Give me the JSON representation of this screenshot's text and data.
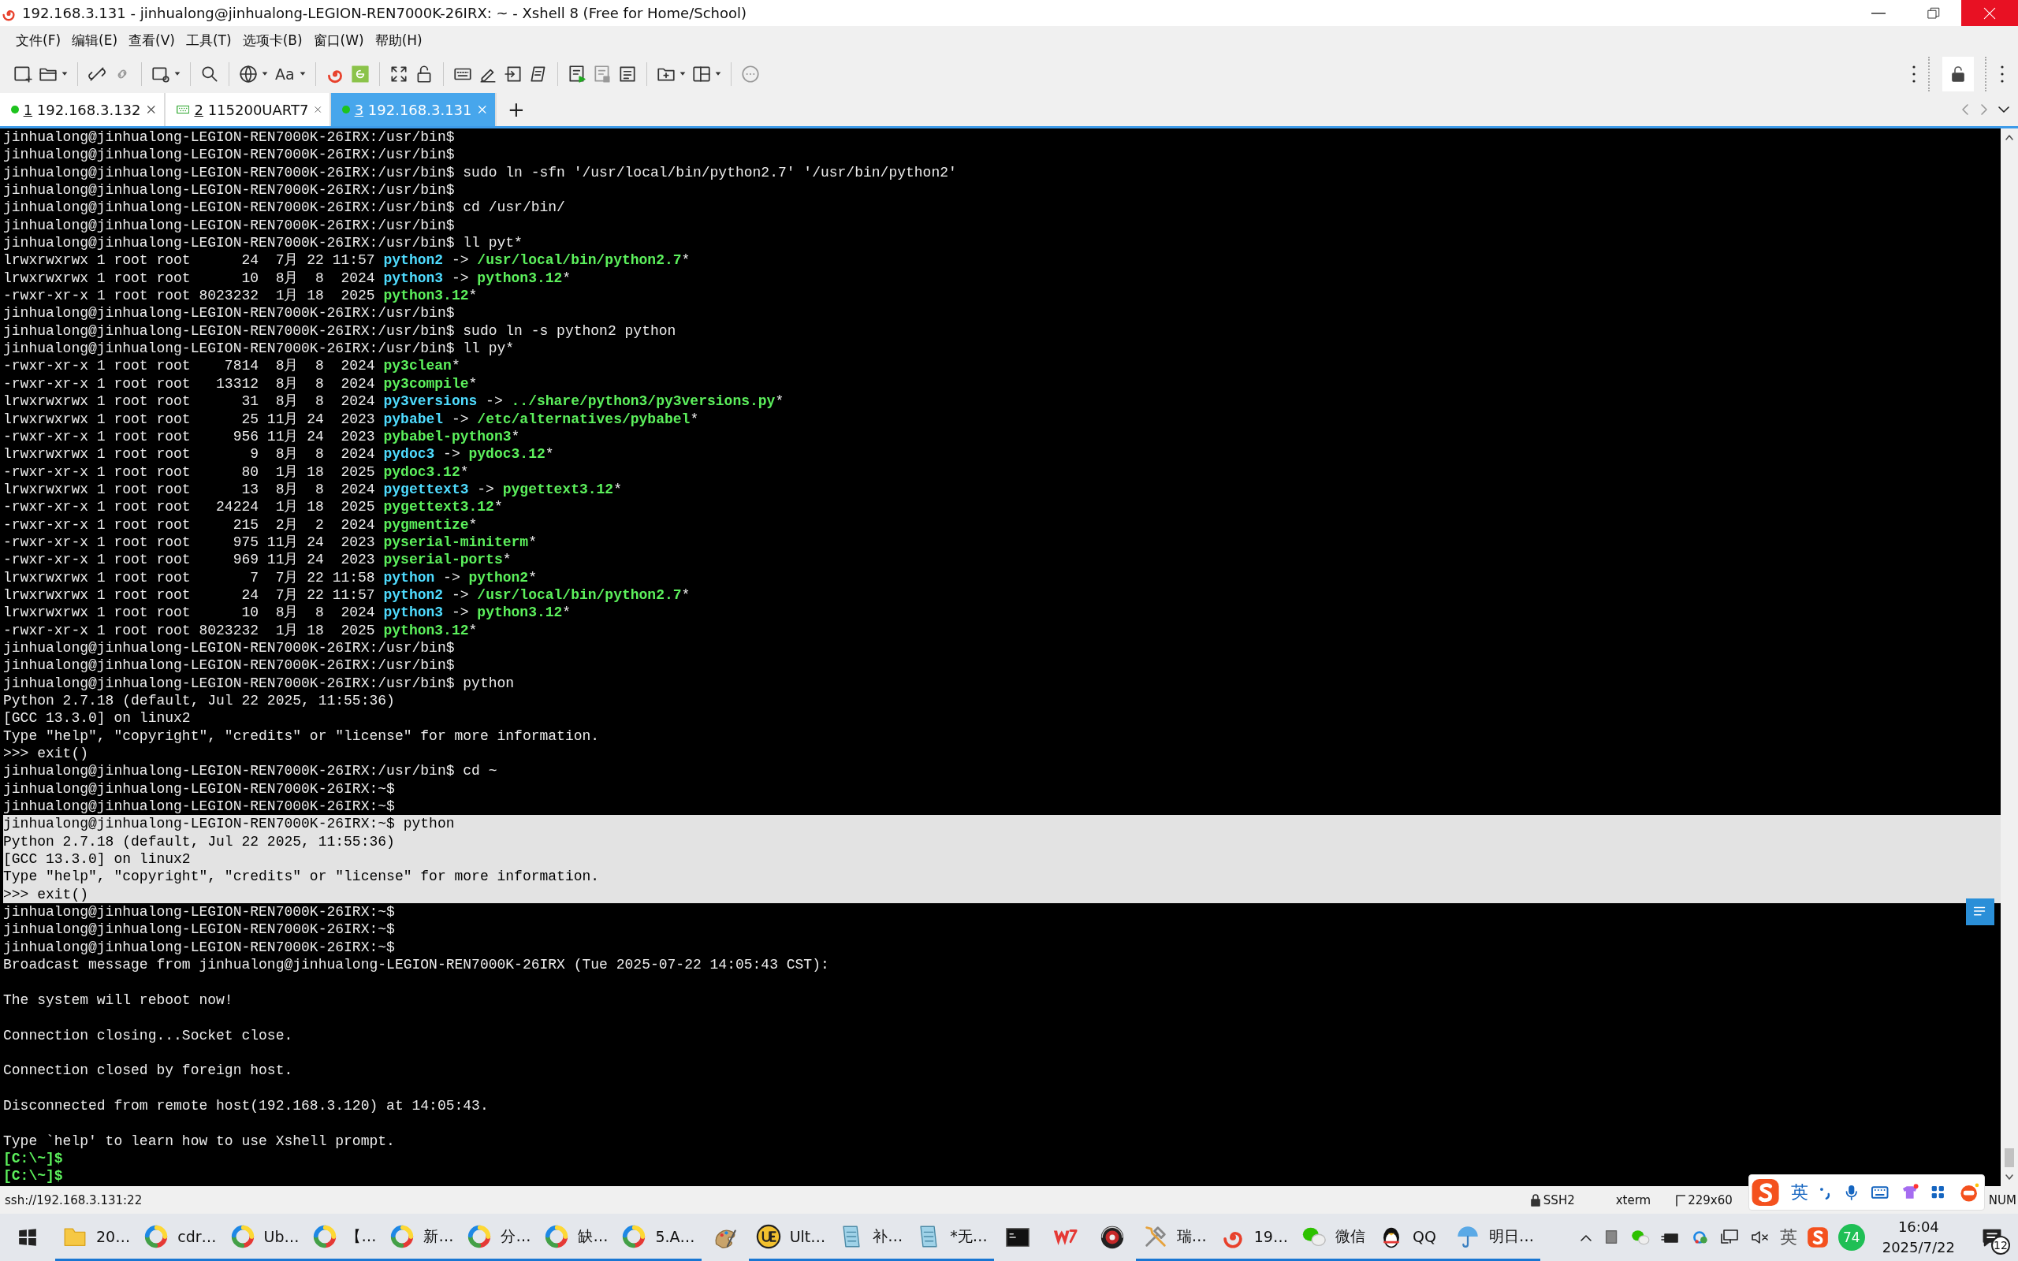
{
  "window": {
    "title": "192.168.3.131 - jinhualong@jinhualong-LEGION-REN7000K-26IRX: ~ - Xshell 8 (Free for Home/School)"
  },
  "menu": [
    "文件(F)",
    "编辑(E)",
    "查看(V)",
    "工具(T)",
    "选项卡(B)",
    "窗口(W)",
    "帮助(H)"
  ],
  "toolbar": {
    "font_button": "Aa"
  },
  "tabs": [
    {
      "number": "1",
      "label": "192.168.3.132",
      "kind": "ssh",
      "connected": true,
      "selected": false
    },
    {
      "number": "2",
      "label": "115200UART7",
      "kind": "serial",
      "selected": false
    },
    {
      "number": "3",
      "label": "192.168.3.131",
      "kind": "ssh",
      "connected": true,
      "selected": true
    }
  ],
  "new_tab": "+",
  "terminal": {
    "lines": [
      {
        "text": "jinhualong@jinhualong-LEGION-REN7000K-26IRX:/usr/bin$",
        "selected": false
      },
      {
        "text": "jinhualong@jinhualong-LEGION-REN7000K-26IRX:/usr/bin$",
        "selected": false
      },
      {
        "text": "jinhualong@jinhualong-LEGION-REN7000K-26IRX:/usr/bin$ sudo ln -sfn '/usr/local/bin/python2.7' '/usr/bin/python2'",
        "selected": false
      },
      {
        "text": "jinhualong@jinhualong-LEGION-REN7000K-26IRX:/usr/bin$",
        "selected": false
      },
      {
        "text": "jinhualong@jinhualong-LEGION-REN7000K-26IRX:/usr/bin$ cd /usr/bin/",
        "selected": false
      },
      {
        "text": "jinhualong@jinhualong-LEGION-REN7000K-26IRX:/usr/bin$",
        "selected": false
      },
      {
        "text": "jinhualong@jinhualong-LEGION-REN7000K-26IRX:/usr/bin$ ll pyt*",
        "selected": false
      },
      {
        "selected": false,
        "segments": [
          {
            "kind": "plain",
            "text": "lrwxrwxrwx 1 root root      24  7月 22 11:57 "
          },
          {
            "kind": "link",
            "text": "python2"
          },
          {
            "kind": "plain",
            "text": " -> "
          },
          {
            "kind": "exec",
            "text": "/usr/local/bin/python2.7"
          },
          {
            "kind": "plain",
            "text": "*"
          }
        ]
      },
      {
        "selected": false,
        "segments": [
          {
            "kind": "plain",
            "text": "lrwxrwxrwx 1 root root      10  8月  8  2024 "
          },
          {
            "kind": "link",
            "text": "python3"
          },
          {
            "kind": "plain",
            "text": " -> "
          },
          {
            "kind": "exec",
            "text": "python3.12"
          },
          {
            "kind": "plain",
            "text": "*"
          }
        ]
      },
      {
        "selected": false,
        "segments": [
          {
            "kind": "plain",
            "text": "-rwxr-xr-x 1 root root 8023232  1月 18  2025 "
          },
          {
            "kind": "exec",
            "text": "python3.12"
          },
          {
            "kind": "plain",
            "text": "*"
          }
        ]
      },
      {
        "text": "jinhualong@jinhualong-LEGION-REN7000K-26IRX:/usr/bin$",
        "selected": false
      },
      {
        "text": "jinhualong@jinhualong-LEGION-REN7000K-26IRX:/usr/bin$ sudo ln -s python2 python",
        "selected": false
      },
      {
        "text": "jinhualong@jinhualong-LEGION-REN7000K-26IRX:/usr/bin$ ll py*",
        "selected": false
      },
      {
        "selected": false,
        "segments": [
          {
            "kind": "plain",
            "text": "-rwxr-xr-x 1 root root    7814  8月  8  2024 "
          },
          {
            "kind": "exec",
            "text": "py3clean"
          },
          {
            "kind": "plain",
            "text": "*"
          }
        ]
      },
      {
        "selected": false,
        "segments": [
          {
            "kind": "plain",
            "text": "-rwxr-xr-x 1 root root   13312  8月  8  2024 "
          },
          {
            "kind": "exec",
            "text": "py3compile"
          },
          {
            "kind": "plain",
            "text": "*"
          }
        ]
      },
      {
        "selected": false,
        "segments": [
          {
            "kind": "plain",
            "text": "lrwxrwxrwx 1 root root      31  8月  8  2024 "
          },
          {
            "kind": "link",
            "text": "py3versions"
          },
          {
            "kind": "plain",
            "text": " -> "
          },
          {
            "kind": "exec",
            "text": "../share/python3/py3versions.py"
          },
          {
            "kind": "plain",
            "text": "*"
          }
        ]
      },
      {
        "selected": false,
        "segments": [
          {
            "kind": "plain",
            "text": "lrwxrwxrwx 1 root root      25 11月 24  2023 "
          },
          {
            "kind": "link",
            "text": "pybabel"
          },
          {
            "kind": "plain",
            "text": " -> "
          },
          {
            "kind": "exec",
            "text": "/etc/alternatives/pybabel"
          },
          {
            "kind": "plain",
            "text": "*"
          }
        ]
      },
      {
        "selected": false,
        "segments": [
          {
            "kind": "plain",
            "text": "-rwxr-xr-x 1 root root     956 11月 24  2023 "
          },
          {
            "kind": "exec",
            "text": "pybabel-python3"
          },
          {
            "kind": "plain",
            "text": "*"
          }
        ]
      },
      {
        "selected": false,
        "segments": [
          {
            "kind": "plain",
            "text": "lrwxrwxrwx 1 root root       9  8月  8  2024 "
          },
          {
            "kind": "link",
            "text": "pydoc3"
          },
          {
            "kind": "plain",
            "text": " -> "
          },
          {
            "kind": "exec",
            "text": "pydoc3.12"
          },
          {
            "kind": "plain",
            "text": "*"
          }
        ]
      },
      {
        "selected": false,
        "segments": [
          {
            "kind": "plain",
            "text": "-rwxr-xr-x 1 root root      80  1月 18  2025 "
          },
          {
            "kind": "exec",
            "text": "pydoc3.12"
          },
          {
            "kind": "plain",
            "text": "*"
          }
        ]
      },
      {
        "selected": false,
        "segments": [
          {
            "kind": "plain",
            "text": "lrwxrwxrwx 1 root root      13  8月  8  2024 "
          },
          {
            "kind": "link",
            "text": "pygettext3"
          },
          {
            "kind": "plain",
            "text": " -> "
          },
          {
            "kind": "exec",
            "text": "pygettext3.12"
          },
          {
            "kind": "plain",
            "text": "*"
          }
        ]
      },
      {
        "selected": false,
        "segments": [
          {
            "kind": "plain",
            "text": "-rwxr-xr-x 1 root root   24224  1月 18  2025 "
          },
          {
            "kind": "exec",
            "text": "pygettext3.12"
          },
          {
            "kind": "plain",
            "text": "*"
          }
        ]
      },
      {
        "selected": false,
        "segments": [
          {
            "kind": "plain",
            "text": "-rwxr-xr-x 1 root root     215  2月  2  2024 "
          },
          {
            "kind": "exec",
            "text": "pygmentize"
          },
          {
            "kind": "plain",
            "text": "*"
          }
        ]
      },
      {
        "selected": false,
        "segments": [
          {
            "kind": "plain",
            "text": "-rwxr-xr-x 1 root root     975 11月 24  2023 "
          },
          {
            "kind": "exec",
            "text": "pyserial-miniterm"
          },
          {
            "kind": "plain",
            "text": "*"
          }
        ]
      },
      {
        "selected": false,
        "segments": [
          {
            "kind": "plain",
            "text": "-rwxr-xr-x 1 root root     969 11月 24  2023 "
          },
          {
            "kind": "exec",
            "text": "pyserial-ports"
          },
          {
            "kind": "plain",
            "text": "*"
          }
        ]
      },
      {
        "selected": false,
        "segments": [
          {
            "kind": "plain",
            "text": "lrwxrwxrwx 1 root root       7  7月 22 11:58 "
          },
          {
            "kind": "link",
            "text": "python"
          },
          {
            "kind": "plain",
            "text": " -> "
          },
          {
            "kind": "exec",
            "text": "python2"
          },
          {
            "kind": "plain",
            "text": "*"
          }
        ]
      },
      {
        "selected": false,
        "segments": [
          {
            "kind": "plain",
            "text": "lrwxrwxrwx 1 root root      24  7月 22 11:57 "
          },
          {
            "kind": "link",
            "text": "python2"
          },
          {
            "kind": "plain",
            "text": " -> "
          },
          {
            "kind": "exec",
            "text": "/usr/local/bin/python2.7"
          },
          {
            "kind": "plain",
            "text": "*"
          }
        ]
      },
      {
        "selected": false,
        "segments": [
          {
            "kind": "plain",
            "text": "lrwxrwxrwx 1 root root      10  8月  8  2024 "
          },
          {
            "kind": "link",
            "text": "python3"
          },
          {
            "kind": "plain",
            "text": " -> "
          },
          {
            "kind": "exec",
            "text": "python3.12"
          },
          {
            "kind": "plain",
            "text": "*"
          }
        ]
      },
      {
        "selected": false,
        "segments": [
          {
            "kind": "plain",
            "text": "-rwxr-xr-x 1 root root 8023232  1月 18  2025 "
          },
          {
            "kind": "exec",
            "text": "python3.12"
          },
          {
            "kind": "plain",
            "text": "*"
          }
        ]
      },
      {
        "text": "jinhualong@jinhualong-LEGION-REN7000K-26IRX:/usr/bin$",
        "selected": false
      },
      {
        "text": "jinhualong@jinhualong-LEGION-REN7000K-26IRX:/usr/bin$",
        "selected": false
      },
      {
        "text": "jinhualong@jinhualong-LEGION-REN7000K-26IRX:/usr/bin$ python",
        "selected": false
      },
      {
        "text": "Python 2.7.18 (default, Jul 22 2025, 11:55:36)",
        "selected": false
      },
      {
        "text": "[GCC 13.3.0] on linux2",
        "selected": false
      },
      {
        "text": "Type \"help\", \"copyright\", \"credits\" or \"license\" for more information.",
        "selected": false
      },
      {
        "text": ">>> exit()",
        "selected": false
      },
      {
        "text": "jinhualong@jinhualong-LEGION-REN7000K-26IRX:/usr/bin$ cd ~",
        "selected": false
      },
      {
        "text": "jinhualong@jinhualong-LEGION-REN7000K-26IRX:~$",
        "selected": false
      },
      {
        "text": "jinhualong@jinhualong-LEGION-REN7000K-26IRX:~$",
        "selected": false
      },
      {
        "text": "jinhualong@jinhualong-LEGION-REN7000K-26IRX:~$ python",
        "selected": true
      },
      {
        "text": "Python 2.7.18 (default, Jul 22 2025, 11:55:36)",
        "selected": true
      },
      {
        "text": "[GCC 13.3.0] on linux2",
        "selected": true
      },
      {
        "text": "Type \"help\", \"copyright\", \"credits\" or \"license\" for more information.",
        "selected": true
      },
      {
        "text": ">>> exit()",
        "selected": true
      },
      {
        "text": "jinhualong@jinhualong-LEGION-REN7000K-26IRX:~$",
        "selected": false
      },
      {
        "text": "jinhualong@jinhualong-LEGION-REN7000K-26IRX:~$",
        "selected": false
      },
      {
        "text": "jinhualong@jinhualong-LEGION-REN7000K-26IRX:~$",
        "selected": false
      },
      {
        "text": "Broadcast message from jinhualong@jinhualong-LEGION-REN7000K-26IRX (Tue 2025-07-22 14:05:43 CST):",
        "selected": false
      },
      {
        "kind": "blank",
        "selected": false
      },
      {
        "text": "The system will reboot now!",
        "selected": false
      },
      {
        "kind": "blank",
        "selected": false
      },
      {
        "text": "Connection closing...Socket close.",
        "selected": false
      },
      {
        "kind": "blank",
        "selected": false
      },
      {
        "text": "Connection closed by foreign host.",
        "selected": false
      },
      {
        "kind": "blank",
        "selected": false
      },
      {
        "text": "Disconnected from remote host(192.168.3.120) at 14:05:43.",
        "selected": false
      },
      {
        "kind": "blank",
        "selected": false
      },
      {
        "text": "Type `help' to learn how to use Xshell prompt.",
        "selected": false
      },
      {
        "selected": false,
        "segments": [
          {
            "kind": "prompt",
            "text": "[C:\\~]$"
          }
        ]
      },
      {
        "selected": false,
        "segments": [
          {
            "kind": "prompt",
            "text": "[C:\\~]$"
          }
        ]
      }
    ]
  },
  "status_bar": {
    "address": "ssh://192.168.3.131:22",
    "protocol": "SSH2",
    "terminal_type": "xterm",
    "size": "229x60",
    "num_lock": "NUM"
  },
  "ime_bar": {
    "language": "英"
  },
  "taskbar": {
    "apps": [
      "20…",
      "cdr…",
      "Ub…",
      "【…",
      "新…",
      "分…",
      "缺…",
      "5.A…",
      "Ult…",
      "补…",
      "*无…",
      "瑞…",
      "19…",
      "微信",
      "QQ",
      "明日…"
    ],
    "tray": {
      "language": "英",
      "battery": "74",
      "time": "16:04",
      "date": "2025/7/22",
      "notifications": "12"
    }
  }
}
